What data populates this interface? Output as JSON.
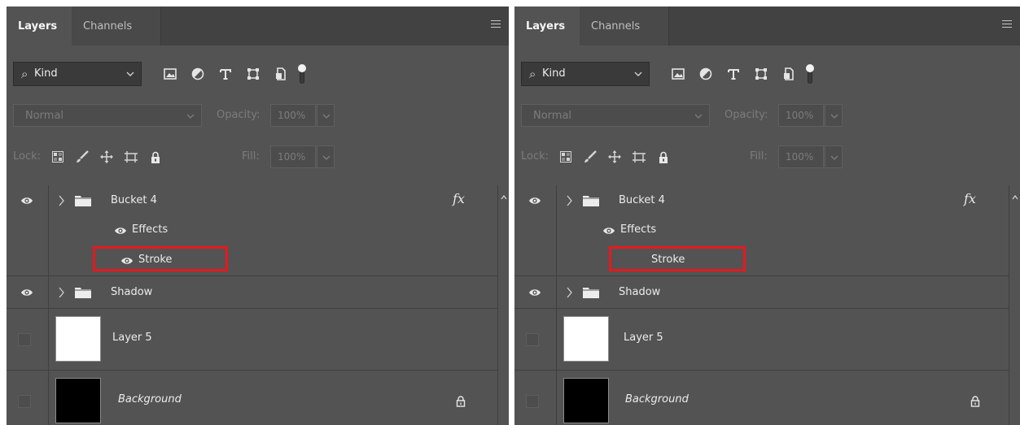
{
  "panels": [
    {
      "tabs": {
        "layers": "Layers",
        "channels": "Channels"
      },
      "filter": {
        "kind": "Kind"
      },
      "blend": {
        "mode": "Normal",
        "opacity_label": "Opacity:",
        "opacity_value": "100%"
      },
      "lock": {
        "label": "Lock:",
        "fill_label": "Fill:",
        "fill_value": "100%"
      },
      "layers": {
        "bucket": {
          "name": "Bucket 4",
          "fx": "fx"
        },
        "effects": {
          "name": "Effects"
        },
        "stroke": {
          "name": "Stroke",
          "visible": true
        },
        "shadow": {
          "name": "Shadow"
        },
        "layer5": {
          "name": "Layer 5"
        },
        "background": {
          "name": "Background"
        }
      }
    },
    {
      "tabs": {
        "layers": "Layers",
        "channels": "Channels"
      },
      "filter": {
        "kind": "Kind"
      },
      "blend": {
        "mode": "Normal",
        "opacity_label": "Opacity:",
        "opacity_value": "100%"
      },
      "lock": {
        "label": "Lock:",
        "fill_label": "Fill:",
        "fill_value": "100%"
      },
      "layers": {
        "bucket": {
          "name": "Bucket 4",
          "fx": "fx"
        },
        "effects": {
          "name": "Effects"
        },
        "stroke": {
          "name": "Stroke",
          "visible": false
        },
        "shadow": {
          "name": "Shadow"
        },
        "layer5": {
          "name": "Layer 5"
        },
        "background": {
          "name": "Background"
        }
      }
    }
  ],
  "colors": {
    "highlight": "#e8181d",
    "panel_bg": "#535353",
    "tab_bar_bg": "#424242"
  },
  "icons": [
    "search-icon",
    "image-filter-icon",
    "adjustment-filter-icon",
    "type-filter-icon",
    "shape-filter-icon",
    "smart-object-filter-icon",
    "eye-icon",
    "folder-icon",
    "lock-icon",
    "panel-menu-icon"
  ]
}
